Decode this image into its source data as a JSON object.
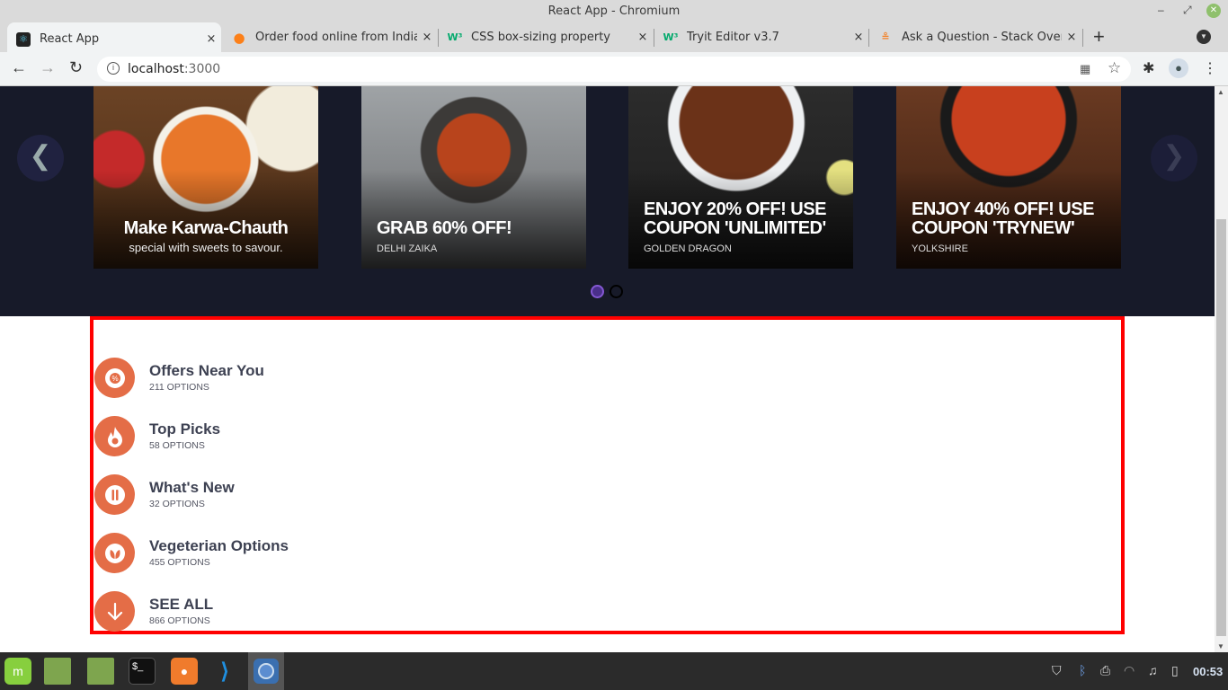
{
  "window": {
    "title": "React App - Chromium",
    "minimize": "–",
    "maximize": "⤢",
    "close": "✕"
  },
  "tabs": [
    {
      "title": "React App",
      "icon": "react-icon",
      "active": true
    },
    {
      "title": "Order food online from India's",
      "icon": "swiggy-icon",
      "active": false
    },
    {
      "title": "CSS box-sizing property",
      "icon": "w3schools-icon",
      "active": false
    },
    {
      "title": "Tryit Editor v3.7",
      "icon": "w3schools-icon",
      "active": false
    },
    {
      "title": "Ask a Question - Stack Overflo",
      "icon": "stackoverflow-icon",
      "active": false
    }
  ],
  "tab_close": "×",
  "new_tab": "+",
  "address_bar": {
    "host": "localhost",
    "port": ":3000"
  },
  "carousel": {
    "prev": "❮",
    "next": "❯",
    "cards": [
      {
        "headline": "Make Karwa-Chauth",
        "sub": "special with sweets to savour."
      },
      {
        "headline": "GRAB 60% OFF!",
        "sub": "DELHI ZAIKA"
      },
      {
        "headline": "ENJOY 20% OFF! USE COUPON 'UNLIMITED'",
        "sub": "GOLDEN DRAGON"
      },
      {
        "headline": "ENJOY 40% OFF! USE COUPON 'TRYNEW'",
        "sub": "YOLKSHIRE"
      }
    ],
    "pages": 2,
    "active_page": 1
  },
  "categories": [
    {
      "name": "Offers Near You",
      "count": "211 OPTIONS",
      "icon": "offer-badge-icon"
    },
    {
      "name": "Top Picks",
      "count": "58 OPTIONS",
      "icon": "flame-icon"
    },
    {
      "name": "What's New",
      "count": "32 OPTIONS",
      "icon": "cutlery-icon"
    },
    {
      "name": "Vegeterian Options",
      "count": "455 OPTIONS",
      "icon": "leaf-icon"
    },
    {
      "name": "SEE ALL",
      "count": "866 OPTIONS",
      "icon": "arrow-down-icon"
    }
  ],
  "colors": {
    "accent": "#e46d47",
    "hero_bg": "#171a29",
    "highlight_border": "#ff0000",
    "dot_active": "#8458d3"
  },
  "taskbar": {
    "clock": "00:53",
    "apps": [
      "mint-menu",
      "files",
      "folder",
      "terminal",
      "firefox",
      "vscode",
      "chromium"
    ]
  }
}
